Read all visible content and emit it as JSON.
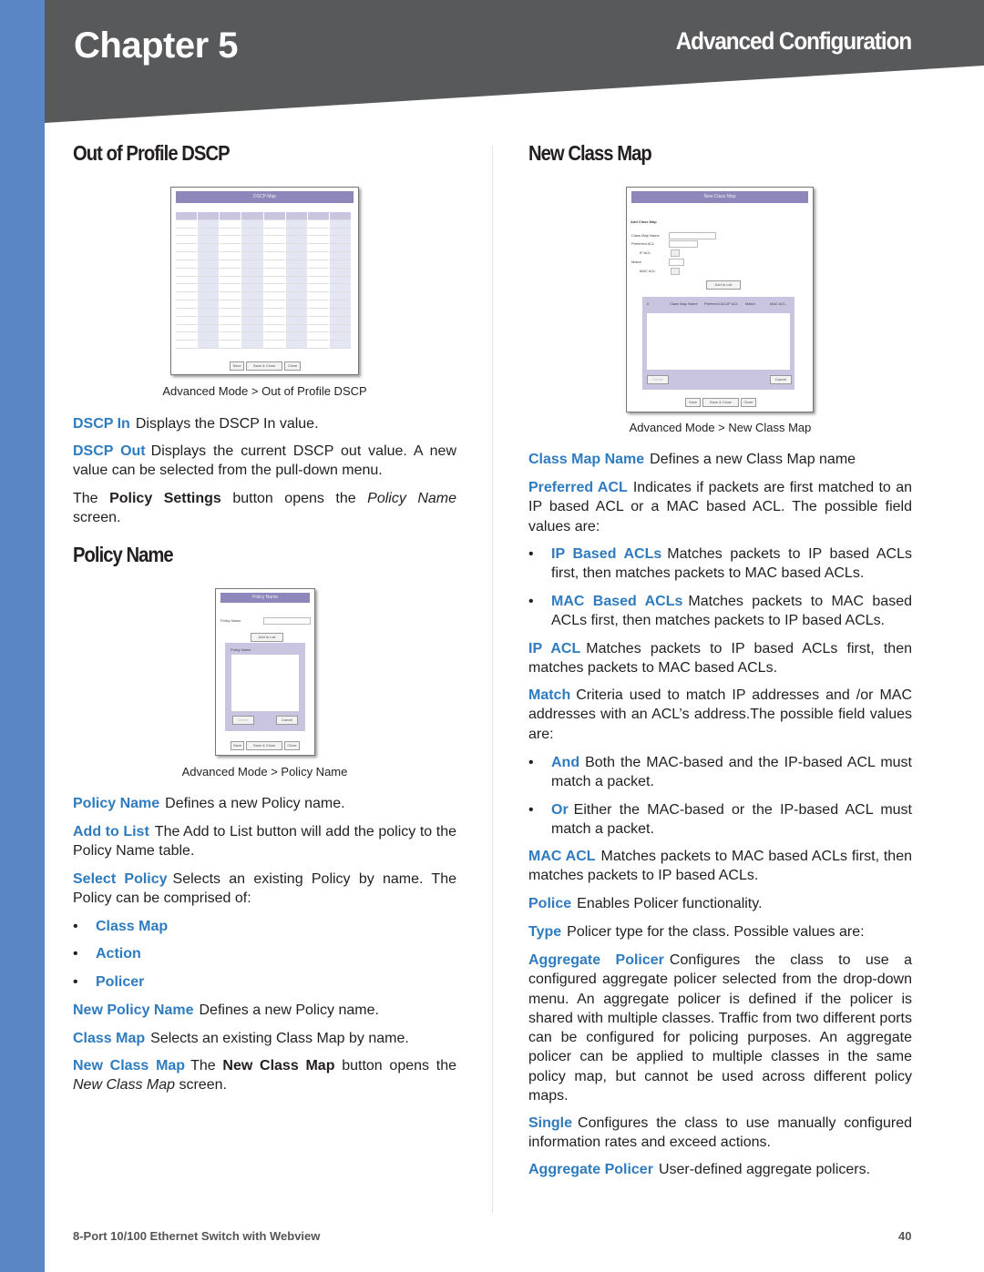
{
  "header": {
    "chapter": "Chapter 5",
    "section": "Advanced Configuration"
  },
  "colors": {
    "sidebar": "#5b86c5",
    "header": "#58595b",
    "term": "#2e7bc0"
  },
  "left": {
    "dscp_title": "Out of Profile DSCP",
    "fig_dscp": {
      "title": "DSCP Map",
      "buttons": [
        "Save",
        "Save & Close",
        "Close"
      ]
    },
    "fig_dscp_caption": "Advanced Mode > Out of Profile DSCP",
    "dscp_in": {
      "term": "DSCP In",
      "text": "Displays the DSCP In value."
    },
    "dscp_out": {
      "term": "DSCP Out",
      "text": "Displays the current DSCP out value. A new value can be selected from the pull-down menu."
    },
    "policy_settings": {
      "pre": "The ",
      "bold": "Policy Settings",
      "mid": " button opens the ",
      "italic": "Policy Name",
      "post": " screen."
    },
    "policy_title": "Policy Name",
    "fig_policy": {
      "title": "Policy Name",
      "field_label": "Policy Name",
      "add_button": "Add to List",
      "list_header": "Policy Name",
      "delete": "Delete",
      "cancel": "Cancel",
      "buttons": [
        "Save",
        "Save & Close",
        "Close"
      ]
    },
    "fig_policy_caption": "Advanced Mode > Policy Name",
    "policy_name": {
      "term": "Policy Name",
      "text": "Defines a new Policy name."
    },
    "add_to_list": {
      "term": "Add to List",
      "text": "The Add to List button will add the policy to the Policy Name table."
    },
    "select_policy": {
      "term": "Select Policy",
      "text": "Selects an existing Policy by name. The Policy can be comprised of:"
    },
    "bullets": [
      "Class Map",
      "Action",
      "Policer"
    ],
    "new_policy_name": {
      "term": "New Policy Name",
      "text": "Defines a new Policy name."
    },
    "class_map": {
      "term": "Class Map",
      "text": "Selects an existing Class Map by name."
    },
    "new_class_map": {
      "term": "New Class Map",
      "pre": "The ",
      "bold": "New Class Map",
      "mid": " button opens the ",
      "italic": "New Class Map",
      "post": " screen."
    }
  },
  "right": {
    "title": "New Class Map",
    "fig_class": {
      "title": "New Class Map",
      "section": "Add Class Map",
      "fields": [
        "Class Map Name",
        "Preferred ACL",
        "IP ACL",
        "Match",
        "MAC ACL"
      ],
      "add_button": "Add to List",
      "columns": [
        "#",
        "Class Map Name",
        "Preferred ACL",
        "IP ACL",
        "Match",
        "MAC ACL"
      ],
      "delete": "Delete",
      "cancel": "Cancel",
      "buttons": [
        "Save",
        "Save & Close",
        "Close"
      ]
    },
    "fig_class_caption": "Advanced Mode > New Class Map",
    "class_map_name": {
      "term": "Class Map Name",
      "text": "Defines a new Class Map name"
    },
    "preferred_acl": {
      "term": "Preferred ACL",
      "text": "Indicates if packets are first matched to an IP based ACL or a MAC based ACL. The possible field values are:"
    },
    "pref_bullets": [
      {
        "term": "IP Based ACLs",
        "text": "Matches packets to IP based ACLs first, then matches packets to MAC based ACLs."
      },
      {
        "term": "MAC Based ACLs",
        "text": "Matches packets to MAC based ACLs first, then matches packets to IP based ACLs."
      }
    ],
    "ip_acl": {
      "term": "IP ACL",
      "text": "Matches packets to IP based ACLs first, then matches packets to MAC based ACLs."
    },
    "match": {
      "term": "Match",
      "text": "Criteria used to match IP addresses and /or MAC addresses with an ACL’s address.The possible field values are:"
    },
    "match_bullets": [
      {
        "term": "And",
        "text": "Both the MAC-based and the IP-based ACL must match a packet."
      },
      {
        "term": "Or",
        "text": "Either the MAC-based or the IP-based ACL must match a packet."
      }
    ],
    "mac_acl": {
      "term": "MAC ACL",
      "text": "Matches packets to MAC based ACLs first, then matches packets to IP based ACLs."
    },
    "police": {
      "term": "Police",
      "text": "Enables Policer functionality."
    },
    "type": {
      "term": "Type",
      "text": "Policer type for the class. Possible values are:"
    },
    "aggregate_policer": {
      "term": "Aggregate Policer",
      "text": "Configures the class to use a configured aggregate policer selected from the drop-down menu. An aggregate policer is defined if the policer is shared with multiple classes. Traffic from two different ports can be configured for policing purposes. An aggregate policer can be applied to multiple classes in the same policy map, but cannot be used across different policy maps."
    },
    "single": {
      "term": "Single",
      "text": "Configures the class to use manually configured information rates and exceed actions."
    },
    "aggregate_policer2": {
      "term": "Aggregate Policer",
      "text": "User-defined aggregate policers."
    }
  },
  "footer": {
    "product": "8-Port 10/100 Ethernet Switch with Webview",
    "page": "40"
  }
}
